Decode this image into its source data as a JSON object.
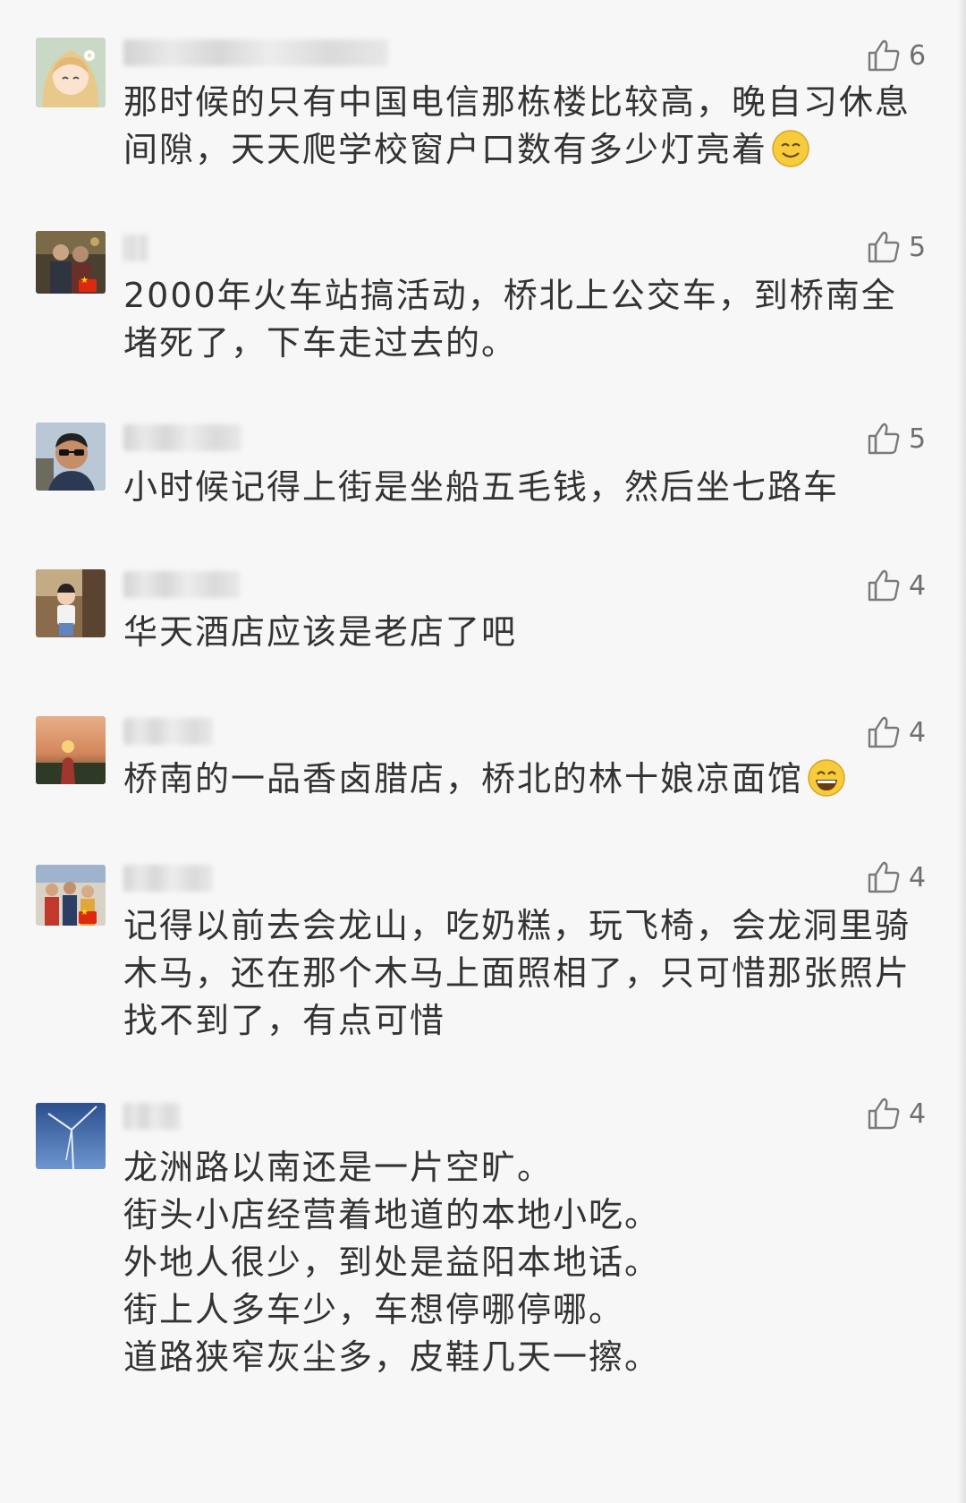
{
  "comments": [
    {
      "likes": "6",
      "text": "那时候的只有中国电信那栋楼比较高，晚自习休息间隙，天天爬学校窗户口数有多少灯亮着",
      "trailing_emoji": "smile-emoji",
      "avatar_icon": "cartoon-girl-avatar"
    },
    {
      "likes": "5",
      "text": "2000年火车站搞活动，桥北上公交车，到桥南全堵死了，下车走过去的。",
      "avatar_icon": "couple-photo-avatar"
    },
    {
      "likes": "5",
      "text": "小时候记得上街是坐船五毛钱，然后坐七路车",
      "avatar_icon": "man-sunglasses-avatar"
    },
    {
      "likes": "4",
      "text": "华天酒店应该是老店了吧",
      "avatar_icon": "child-photo-avatar"
    },
    {
      "likes": "4",
      "text": "桥南的一品香卤腊店，桥北的林十娘凉面馆",
      "trailing_emoji": "grin-emoji",
      "avatar_icon": "sunset-photo-avatar"
    },
    {
      "likes": "4",
      "text": "记得以前去会龙山，吃奶糕，玩飞椅，会龙洞里骑木马，还在那个木马上面照相了，只可惜那张照片找不到了，有点可惜",
      "avatar_icon": "group-photo-avatar"
    },
    {
      "likes": "4",
      "text": "龙洲路以南还是一片空旷。\n街头小店经营着地道的本地小吃。\n外地人很少，到处是益阳本地话。\n街上人多车少，车想停哪停哪。\n道路狭窄灰尘多，皮鞋几天一擦。",
      "avatar_icon": "wind-turbine-avatar"
    }
  ],
  "colors": {
    "text": "#333333",
    "like_count": "#6f6f6f",
    "background": "#f7f7f7"
  }
}
